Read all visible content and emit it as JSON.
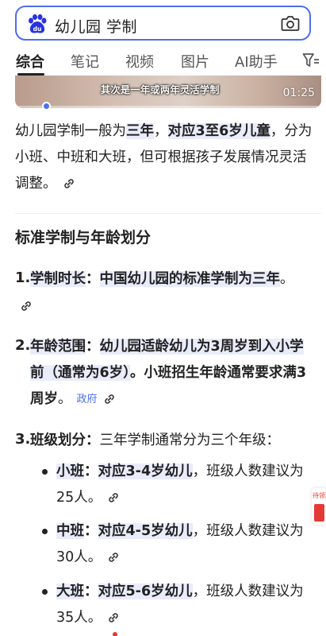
{
  "search": {
    "query": "幼儿园 学制"
  },
  "tabs": [
    {
      "label": "综合"
    },
    {
      "label": "笔记"
    },
    {
      "label": "视频"
    },
    {
      "label": "图片"
    },
    {
      "label": "AI助手"
    }
  ],
  "video": {
    "caption": "其次是一年或两年灵活学制",
    "duration": "01:25"
  },
  "intro": {
    "t1": "幼儿园学制一般为",
    "h1": "三年",
    "t2": "，",
    "h2": "对应3至6岁儿童",
    "t3": "，分为小班、中班和大班，但可根据孩子发展情况灵活调整。"
  },
  "section": {
    "heading": "标准学制与年龄划分"
  },
  "items": [
    {
      "num": "1.",
      "title": "学制时长",
      "colon": "：",
      "text": "中国幼儿园的标准学制为",
      "hl": "三年",
      "end": "。"
    },
    {
      "num": "2.",
      "title": "年龄范围",
      "colon": "：",
      "text": "幼儿园适龄幼儿为3周岁到入小学前（通常为6岁）",
      "text2": "。小班招生年龄通常要求满3周岁",
      "end": "。",
      "tag": "政府"
    },
    {
      "num": "3.",
      "title": "班级划分",
      "colon": "：",
      "text": "三年学制通常分为三个年级："
    }
  ],
  "classes": [
    {
      "name": "小班",
      "colon": "：",
      "hl": "对应3-4岁幼儿",
      "text": "，班级人数建议为25人。"
    },
    {
      "name": "中班",
      "colon": "：",
      "hl": "对应4-5岁幼儿",
      "text": "，班级人数建议为30人。"
    },
    {
      "name": "大班",
      "colon": "：",
      "hl": "对应5-6岁幼儿",
      "text": "，班级人数建议为35人。"
    }
  ],
  "side_float": {
    "label": "待领取"
  },
  "colors": {
    "accent": "#4e6ef2",
    "highlight": "#e9ecfb",
    "red": "#e53935"
  },
  "icons": [
    "baidu-logo-icon",
    "camera-icon",
    "filter-icon",
    "link-icon"
  ]
}
